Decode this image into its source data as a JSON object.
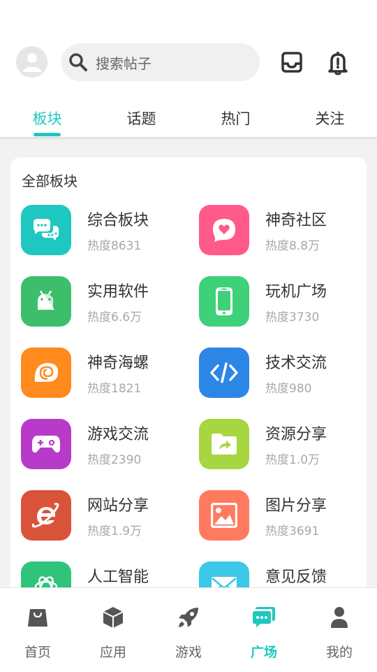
{
  "header": {
    "search_placeholder": "搜索帖子",
    "icons": [
      "avatar-icon",
      "search-icon",
      "inbox-icon",
      "bell-icon"
    ]
  },
  "tabs": [
    {
      "label": "板块",
      "active": true
    },
    {
      "label": "话题",
      "active": false
    },
    {
      "label": "热门",
      "active": false
    },
    {
      "label": "关注",
      "active": false
    }
  ],
  "section": {
    "title": "全部板块",
    "boards": [
      {
        "name": "综合板块",
        "heat": "热度8631",
        "color": "#1ec8c0",
        "icon": "chat-icon"
      },
      {
        "name": "神奇社区",
        "heat": "热度8.8万",
        "color": "#ff5a8a",
        "icon": "heart-bubble-icon"
      },
      {
        "name": "实用软件",
        "heat": "热度6.6万",
        "color": "#3dbe6a",
        "icon": "android-icon"
      },
      {
        "name": "玩机广场",
        "heat": "热度3730",
        "color": "#3fd07a",
        "icon": "phone-icon"
      },
      {
        "name": "神奇海螺",
        "heat": "热度1821",
        "color": "#ff8a1e",
        "icon": "conch-icon"
      },
      {
        "name": "技术交流",
        "heat": "热度980",
        "color": "#2b86e6",
        "icon": "code-icon"
      },
      {
        "name": "游戏交流",
        "heat": "热度2390",
        "color": "#b83ac8",
        "icon": "gamepad-icon"
      },
      {
        "name": "资源分享",
        "heat": "热度1.0万",
        "color": "#a6d640",
        "icon": "folder-share-icon"
      },
      {
        "name": "网站分享",
        "heat": "热度1.9万",
        "color": "#d9533a",
        "icon": "ie-icon"
      },
      {
        "name": "图片分享",
        "heat": "热度3691",
        "color": "#ff7a5e",
        "icon": "image-icon"
      },
      {
        "name": "人工智能",
        "heat": "",
        "color": "#2ec47a",
        "icon": "ai-icon"
      },
      {
        "name": "意见反馈",
        "heat": "",
        "color": "#3cc8e8",
        "icon": "mail-icon"
      }
    ]
  },
  "bottom_nav": [
    {
      "label": "首页",
      "icon": "home-bag-icon",
      "active": false
    },
    {
      "label": "应用",
      "icon": "cube-icon",
      "active": false
    },
    {
      "label": "游戏",
      "icon": "rocket-icon",
      "active": false
    },
    {
      "label": "广场",
      "icon": "chat-bubbles-icon",
      "active": true
    },
    {
      "label": "我的",
      "icon": "person-icon",
      "active": false
    }
  ],
  "colors": {
    "accent": "#1ec8c0",
    "background": "#f2f2f2"
  }
}
